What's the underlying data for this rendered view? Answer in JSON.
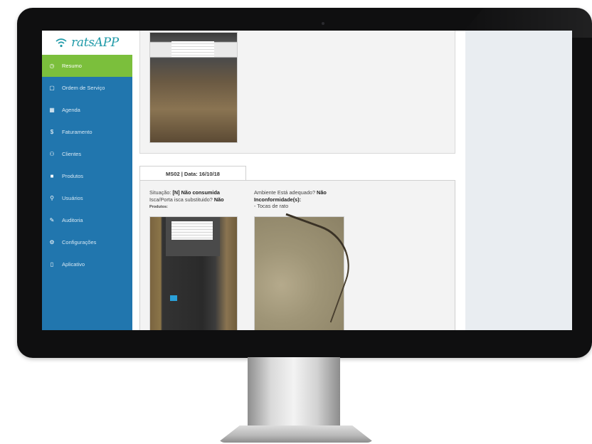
{
  "app": {
    "brand": "ratsAPP"
  },
  "sidebar": {
    "items": [
      {
        "label": "Resumo",
        "icon": "clock-icon",
        "active": true
      },
      {
        "label": "Ordem de Serviço",
        "icon": "clipboard-icon"
      },
      {
        "label": "Agenda",
        "icon": "calendar-icon"
      },
      {
        "label": "Faturamento",
        "icon": "dollar-icon"
      },
      {
        "label": "Clientes",
        "icon": "users-icon"
      },
      {
        "label": "Produtos",
        "icon": "box-icon"
      },
      {
        "label": "Usuários",
        "icon": "user-icon"
      },
      {
        "label": "Auditoria",
        "icon": "edit-icon"
      },
      {
        "label": "Configurações",
        "icon": "gear-icon"
      },
      {
        "label": "Aplicativo",
        "icon": "mobile-icon"
      }
    ],
    "colors": {
      "background": "#2176ae",
      "active": "#7bbf3c"
    }
  },
  "inspection": {
    "tab_label": "MS02 | Data: 16/10/18",
    "situacao_label": "Situação:",
    "situacao_value": "[N] Não consumida",
    "isca_label": "Isca/Porta isca substituido?",
    "isca_value": "Não",
    "produtos_label": "Produtos:",
    "ambiente_label": "Ambiente Está adequado?",
    "ambiente_value": "Não",
    "inconformidade_label": "Inconformidade(s):",
    "inconformidade_item": "- Tocas de rato"
  }
}
